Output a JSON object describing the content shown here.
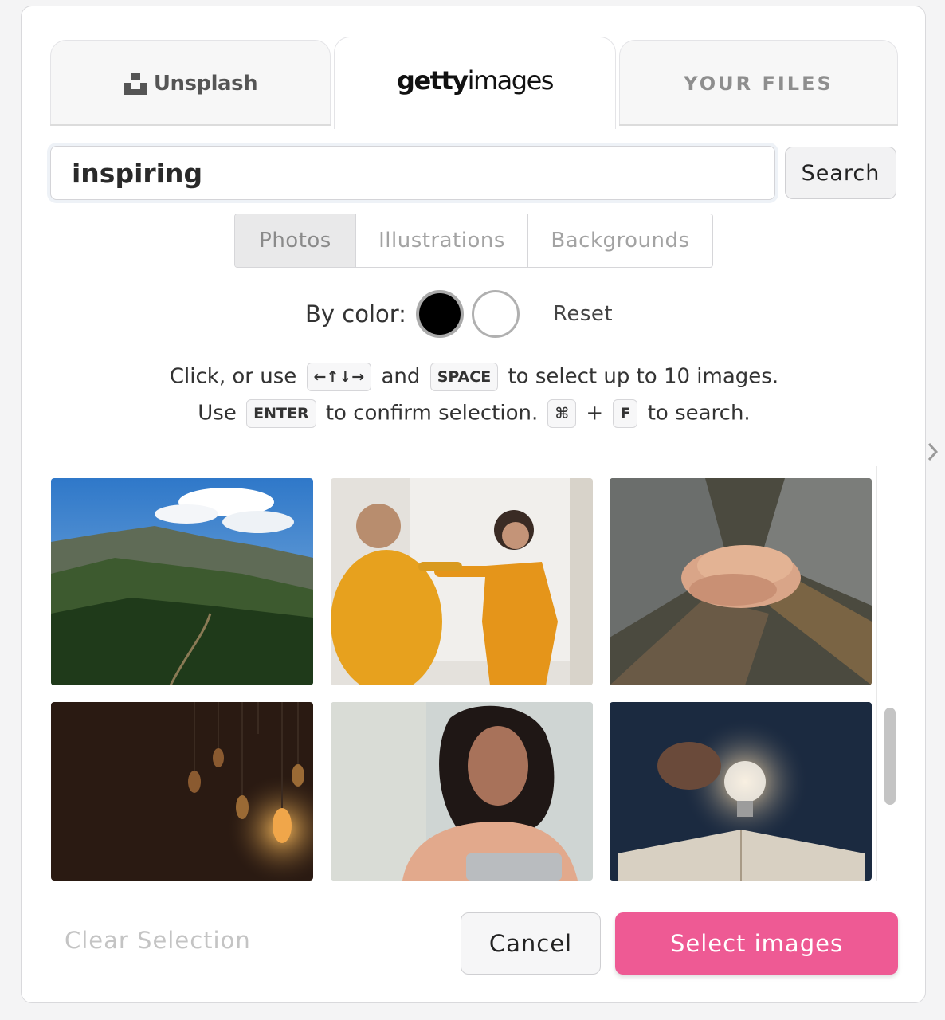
{
  "tabs": [
    {
      "label": "Unsplash",
      "icon": "unsplash-logo-icon"
    },
    {
      "label_bold": "getty",
      "label_light": "images"
    },
    {
      "label": "YOUR FILES"
    }
  ],
  "search": {
    "value": "inspiring",
    "button_label": "Search"
  },
  "filters": [
    "Photos",
    "Illustrations",
    "Backgrounds"
  ],
  "color_filter": {
    "label": "By color:",
    "swatches": [
      "#000000",
      "#ffffff"
    ],
    "reset_label": "Reset"
  },
  "help": {
    "line1_a": "Click, or use",
    "arrows_key": "←↑↓→",
    "line1_b": "and",
    "space_key": "SPACE",
    "line1_c": "to select up to 10 images.",
    "line2_a": "Use",
    "enter_key": "ENTER",
    "line2_b": "to confirm selection.",
    "cmd_key": "⌘",
    "plus": "+",
    "f_key": "F",
    "line2_c": "to search."
  },
  "images": [
    {
      "subject": "mountain landscape"
    },
    {
      "subject": "women pointing"
    },
    {
      "subject": "stacked hands"
    },
    {
      "subject": "hanging light bulbs"
    },
    {
      "subject": "smiling woman"
    },
    {
      "subject": "glowing bulb on book"
    }
  ],
  "footer": {
    "clear_label": "Clear Selection",
    "cancel_label": "Cancel",
    "select_label": "Select images"
  },
  "colors": {
    "accent": "#ee5a94"
  }
}
